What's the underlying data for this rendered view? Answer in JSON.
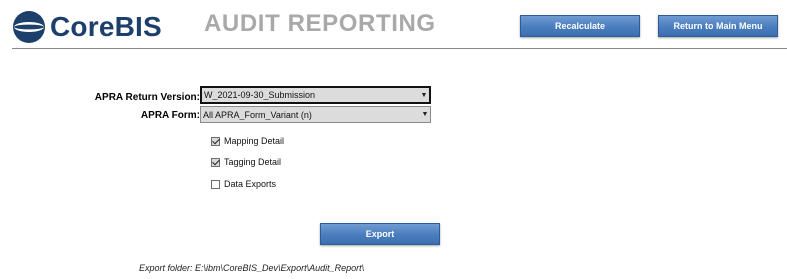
{
  "header": {
    "logo_text": "CoreBIS",
    "title": "AUDIT REPORTING",
    "recalculate_label": "Recalculate",
    "return_label": "Return to Main Menu"
  },
  "form": {
    "version_label": "APRA Return Version:",
    "version_value": "W_2021-09-30_Submission",
    "form_label": "APRA Form:",
    "form_value": "All APRA_Form_Variant (n)"
  },
  "options": [
    {
      "label": "Mapping Detail",
      "checked": true
    },
    {
      "label": "Tagging Detail",
      "checked": true
    },
    {
      "label": "Data Exports",
      "checked": false
    }
  ],
  "export": {
    "button_label": "Export",
    "folder_text": "Export folder: E:\\ibm\\CoreBIS_Dev\\Export\\Audit_Report\\"
  },
  "colors": {
    "brand": "#1d3f6b",
    "button": "#4a7dbf",
    "title_gray": "#a9a9a9"
  },
  "icons": {
    "logo": "corebis-logo-icon",
    "dropdown": "chevron-down-icon",
    "check": "check-icon"
  }
}
